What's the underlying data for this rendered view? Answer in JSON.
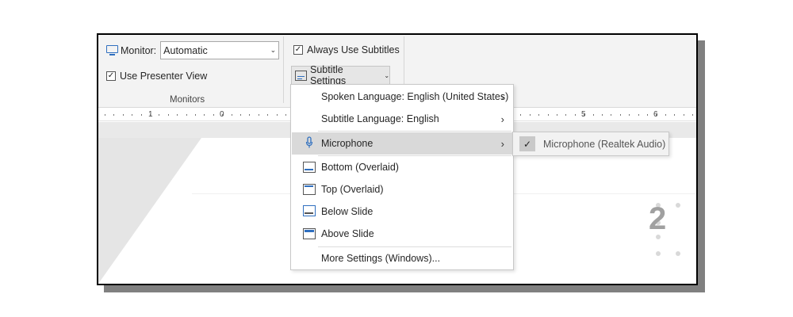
{
  "ribbon": {
    "monitor_label": "Monitor:",
    "monitor_value": "Automatic",
    "use_presenter_view": {
      "label": "Use Presenter View",
      "checked": true
    },
    "group_label": "Monitors",
    "always_use_subtitles": {
      "label": "Always Use Subtitles",
      "checked": true
    },
    "subtitle_settings_label": "Subtitle Settings"
  },
  "ruler": {
    "labels": [
      "1",
      "0",
      "5",
      "6"
    ]
  },
  "slide": {
    "number": "2"
  },
  "menu": {
    "items": [
      {
        "label": "Spoken Language: English (United States)",
        "has_submenu": true
      },
      {
        "label": "Subtitle Language: English",
        "has_submenu": true
      },
      {
        "label": "Microphone",
        "has_submenu": true,
        "icon": "microphone-icon"
      },
      {
        "label": "Bottom (Overlaid)",
        "icon": "bottom-overlaid-icon"
      },
      {
        "label": "Top (Overlaid)",
        "icon": "top-overlaid-icon"
      },
      {
        "label": "Below Slide",
        "icon": "below-slide-icon"
      },
      {
        "label": "Above Slide",
        "icon": "above-slide-icon"
      },
      {
        "label": "More Settings (Windows)..."
      }
    ]
  },
  "submenu": {
    "label": "Microphone (Realtek Audio)",
    "checked": true
  },
  "colors": {
    "accent": "#2f6fbf",
    "highlight": "#d9d9d9"
  }
}
